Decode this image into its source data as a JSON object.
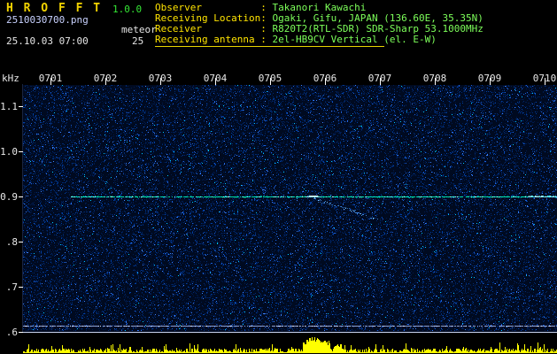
{
  "header": {
    "app_name": "H R O F F T",
    "version": "1.0.0",
    "filename": "2510030700.png",
    "mode": "meteor",
    "timestamp": "25.10.03 07:00",
    "count": "25",
    "info": [
      {
        "label": "Observer",
        "value": "Takanori Kawachi"
      },
      {
        "label": "Receiving Location",
        "value": "Ogaki, Gifu, JAPAN (136.60E, 35.35N)"
      },
      {
        "label": "Receiver",
        "value": "R820T2(RTL-SDR) SDR-Sharp 53.1000MHz"
      },
      {
        "label": "Receiving antenna",
        "value": "2el-HB9CV Vertical (el. E-W)"
      }
    ]
  },
  "colors": {
    "title_yellow": "#f2d300",
    "version_green": "#35e835",
    "filename_blue": "#c9d2ff",
    "label_yellow": "#ffe400",
    "value_green": "#7dff5a",
    "bar_yellow": "#ffff00",
    "carrier_cyan": "#00f5d0",
    "noise_navy": "#000a20"
  },
  "chart_data": {
    "type": "heatmap",
    "title": "HROFFT 10-minute meteor-echo spectrogram",
    "x_tick_labels": [
      "0701",
      "0702",
      "0703",
      "0704",
      "0705",
      "0706",
      "0707",
      "0708",
      "0709",
      "0710"
    ],
    "y_unit": "kHz",
    "y_tick_labels": [
      "1.1",
      "1.0",
      "0.9",
      ".8",
      ".7",
      ".6"
    ],
    "y_tick_values": [
      1.1,
      1.0,
      0.9,
      0.8,
      0.7,
      0.6
    ],
    "y_range_khz": [
      0.6,
      1.15
    ],
    "carrier_khz": 0.9,
    "carrier_start_x_label": "0701",
    "events": [
      {
        "type": "meteor-echo",
        "time": "0706",
        "freq_khz": 0.9,
        "shape": "descending-tail"
      }
    ],
    "activity_strip": {
      "peak_time": "0706",
      "baseline": "low-random"
    }
  }
}
